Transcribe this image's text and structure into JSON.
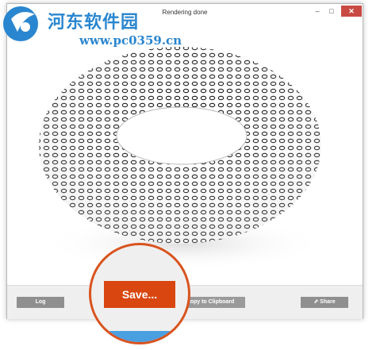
{
  "window": {
    "title": "Rendering done",
    "controls": {
      "minimize": "–",
      "maximize": "□",
      "close": "✕"
    }
  },
  "watermark": {
    "name": "河东软件园",
    "url": "www.pc0359.cn"
  },
  "buttons": {
    "log": "Log",
    "save": "Save...",
    "copy": "Copy to Clipboard",
    "share": "Share"
  },
  "colors": {
    "accent": "#d9460f",
    "button_gray": "#8f8f8f",
    "close": "#c94a43",
    "watermark_blue": "#2a86cf"
  },
  "icons": {
    "share": "share-icon",
    "logo": "watermark-logo-icon"
  }
}
